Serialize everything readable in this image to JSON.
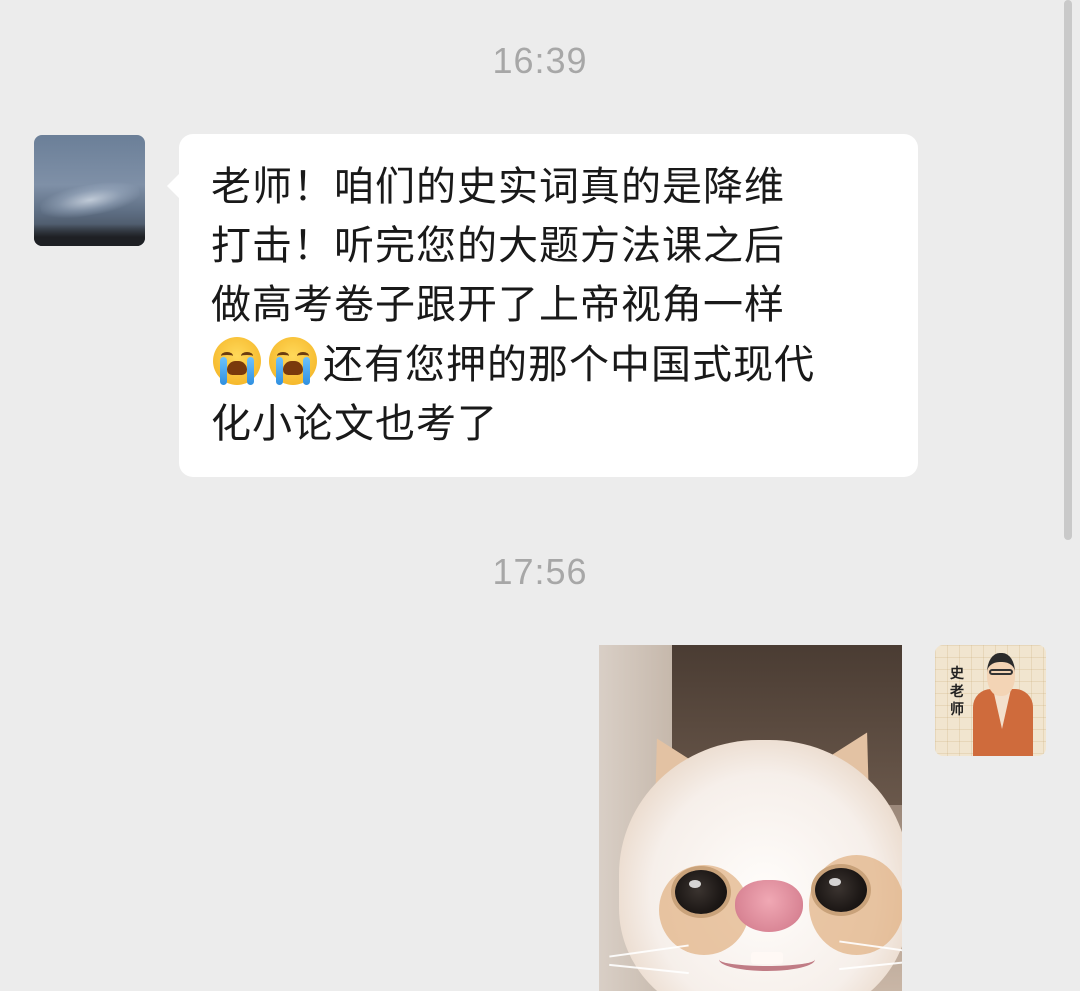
{
  "chat": {
    "timestamps": [
      "16:39",
      "17:56"
    ],
    "incoming": {
      "avatar_icon": "sky-sunset-avatar",
      "lines": [
        "老师！咱们的史实词真的是降维",
        "打击！听完您的大题方法课之后",
        "做高考卷子跟开了上帝视角一样",
        "还有您押的那个中国式现代",
        "化小论文也考了"
      ],
      "emoji": "loudly-crying-face",
      "emoji_count": 2
    },
    "outgoing": {
      "image": "cute-cat-closeup-sticker",
      "avatar_icon": "teacher-illustration-avatar",
      "avatar_sign": [
        "史",
        "老",
        "师"
      ]
    }
  },
  "colors": {
    "background": "#ececec",
    "bubble": "#ffffff",
    "text": "#191919",
    "timestamp": "#a7a7a7"
  }
}
